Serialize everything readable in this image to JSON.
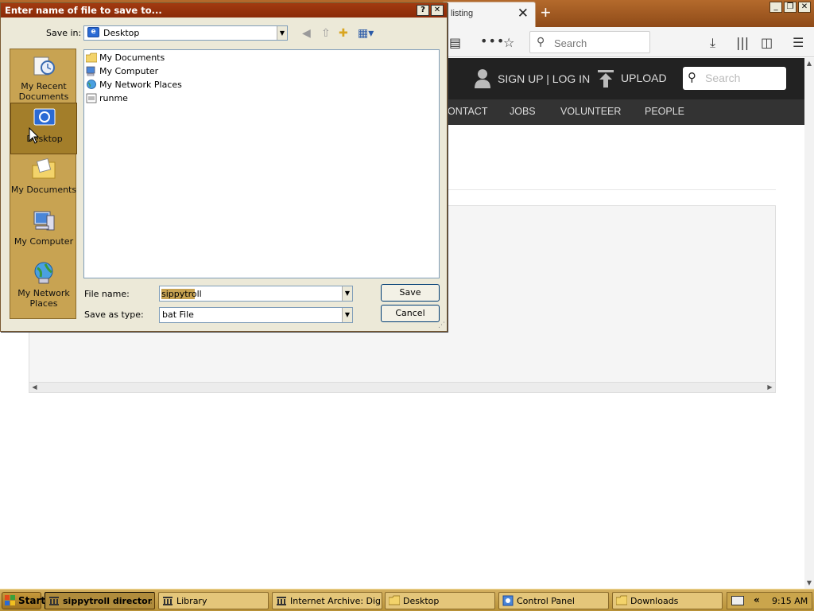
{
  "browser": {
    "tab_title": "listing",
    "tab_close": "✕",
    "new_tab": "+",
    "window_controls": [
      "_",
      "❐",
      "✕"
    ],
    "toolbar_search_placeholder": "Search",
    "header": {
      "signup_login": "SIGN UP | LOG IN",
      "upload": "UPLOAD",
      "search_placeholder": "Search"
    },
    "nav": [
      "ONTACT",
      "JOBS",
      "VOLUNTEER",
      "PEOPLE"
    ],
    "scroll_left": "◀",
    "scroll_right": "▶",
    "scroll_up": "▲",
    "scroll_down": "▼"
  },
  "dialog": {
    "title": "Enter name of file to save to...",
    "help_button": "?",
    "close_button": "✕",
    "save_in_label": "Save in:",
    "save_in_value": "Desktop",
    "places": [
      "My Recent Documents",
      "Desktop",
      "My Documents",
      "My Computer",
      "My Network Places"
    ],
    "files": [
      "My Documents",
      "My Computer",
      "My Network Places",
      "runme"
    ],
    "file_name_label": "File name:",
    "file_name_value": "sippytroll",
    "save_as_type_label": "Save as type:",
    "save_as_type_value": "bat File",
    "save_button": "Save",
    "cancel_button": "Cancel"
  },
  "taskbar": {
    "start": "Start",
    "items": [
      "sippytroll director...",
      "Library",
      "Internet Archive: Digit...",
      "Desktop",
      "Control Panel",
      "Downloads"
    ],
    "tray_chevron": "«",
    "clock": "9:15 AM"
  },
  "colors": {
    "title_bar": "#a23a10",
    "taskbar": "#c9a34e",
    "places_bar": "#c8a352",
    "site_header": "#222222"
  }
}
